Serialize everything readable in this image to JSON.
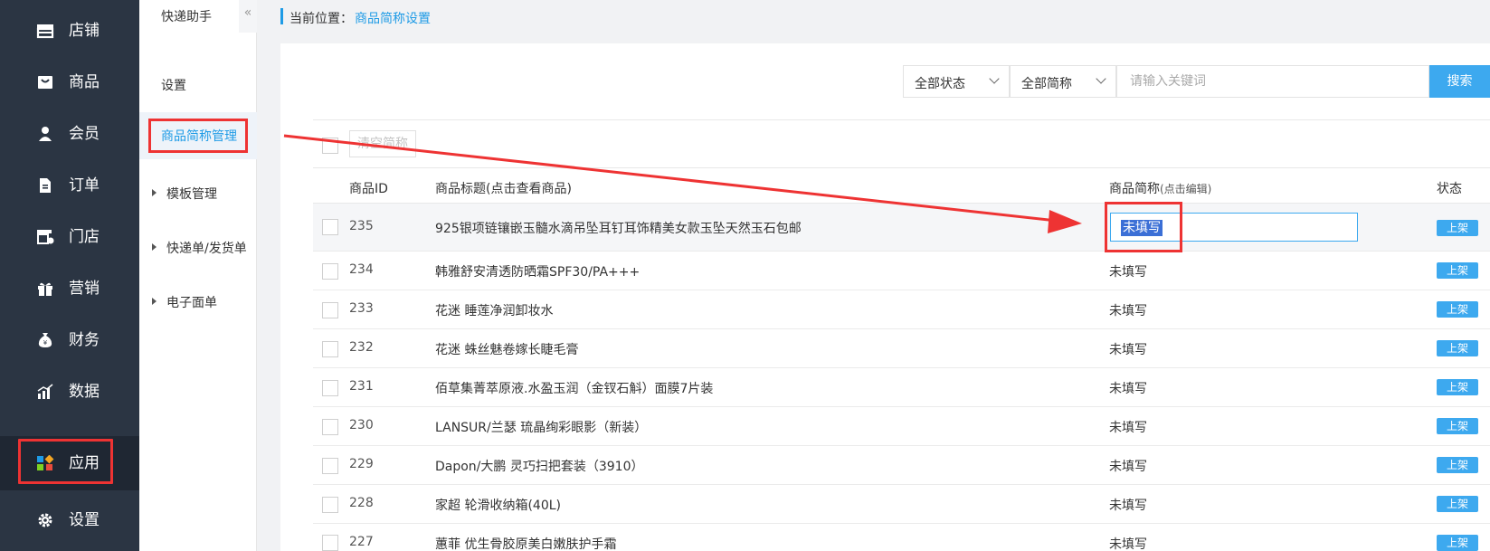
{
  "nav": {
    "items": [
      {
        "label": "店铺",
        "icon": "store-icon"
      },
      {
        "label": "商品",
        "icon": "bag-icon"
      },
      {
        "label": "会员",
        "icon": "user-icon"
      },
      {
        "label": "订单",
        "icon": "document-icon"
      },
      {
        "label": "门店",
        "icon": "shop-settings-icon"
      },
      {
        "label": "营销",
        "icon": "gift-icon"
      },
      {
        "label": "财务",
        "icon": "money-bag-icon"
      },
      {
        "label": "数据",
        "icon": "bar-chart-icon"
      },
      {
        "label": "应用",
        "icon": "apps-icon"
      },
      {
        "label": "设置",
        "icon": "gear-icon"
      }
    ],
    "active_index": 8
  },
  "sidebar": {
    "title": "快递助手",
    "collapse_glyph": "«",
    "items": [
      {
        "label": "设置"
      },
      {
        "label": "商品简称管理"
      },
      {
        "label": "模板管理"
      },
      {
        "label": "快递单/发货单"
      },
      {
        "label": "电子面单"
      }
    ]
  },
  "breadcrumb": {
    "prefix": "当前位置：",
    "current": "商品简称设置"
  },
  "filters": {
    "status_select": "全部状态",
    "abbr_select": "全部简称",
    "search_placeholder": "请输入关键词",
    "search_button": "搜索"
  },
  "toolbar": {
    "clear_button": "清空简称"
  },
  "table": {
    "headers": {
      "id": "商品ID",
      "title": "商品标题(点击查看商品)",
      "abbr_main": "商品简称",
      "abbr_hint": "(点击编辑)",
      "status": "状态"
    },
    "editing_value": "未填写",
    "rows": [
      {
        "id": "235",
        "title": "925银项链镶嵌玉髓水滴吊坠耳钉耳饰精美女款玉坠天然玉石包邮",
        "abbr": "未填写",
        "status": "上架"
      },
      {
        "id": "234",
        "title": "韩雅舒安清透防晒霜SPF30/PA+++",
        "abbr": "未填写",
        "status": "上架"
      },
      {
        "id": "233",
        "title": "花迷 睡莲净润卸妆水",
        "abbr": "未填写",
        "status": "上架"
      },
      {
        "id": "232",
        "title": "花迷 蛛丝魅卷嫁长睫毛膏",
        "abbr": "未填写",
        "status": "上架"
      },
      {
        "id": "231",
        "title": "佰草集菁萃原液.水盈玉润（金钗石斛）面膜7片装",
        "abbr": "未填写",
        "status": "上架"
      },
      {
        "id": "230",
        "title": "LANSUR/兰瑟 琉晶绚彩眼影（新装）",
        "abbr": "未填写",
        "status": "上架"
      },
      {
        "id": "229",
        "title": "Dapon/大鹏 灵巧扫把套装（3910）",
        "abbr": "未填写",
        "status": "上架"
      },
      {
        "id": "228",
        "title": "家超 轮滑收纳箱(40L)",
        "abbr": "未填写",
        "status": "上架"
      },
      {
        "id": "227",
        "title": "蕙菲 优生骨胶原美白嫩肤护手霜",
        "abbr": "未填写",
        "status": "上架"
      }
    ]
  },
  "colors": {
    "accent": "#1e9be6",
    "button": "#3da9ef",
    "nav_bg": "#2b3543",
    "annotation": "#ee3333"
  }
}
